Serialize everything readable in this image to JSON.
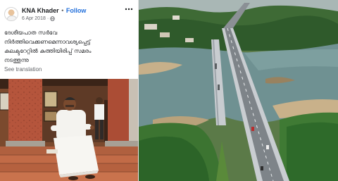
{
  "post": {
    "author": "KNA Khader",
    "separator": "•",
    "follow_label": "Follow",
    "date": "6 Apr 2018",
    "date_separator": "·",
    "more_icon": "more-options-icon",
    "text_lines": [
      "ദേശീയപാത സർവേ",
      "നിർത്തിവെക്കണമെന്നാവശ്യപ്പെട്ട്",
      "കലക്ടറേറ്റിൽ കുത്തിയിരിപ്പ് സമരം",
      "നടത്തുന്നു"
    ],
    "see_translation": "See translation"
  },
  "colors": {
    "link_blue": "#216fdb",
    "text_dark": "#1c1e21",
    "text_muted": "#65676b"
  }
}
